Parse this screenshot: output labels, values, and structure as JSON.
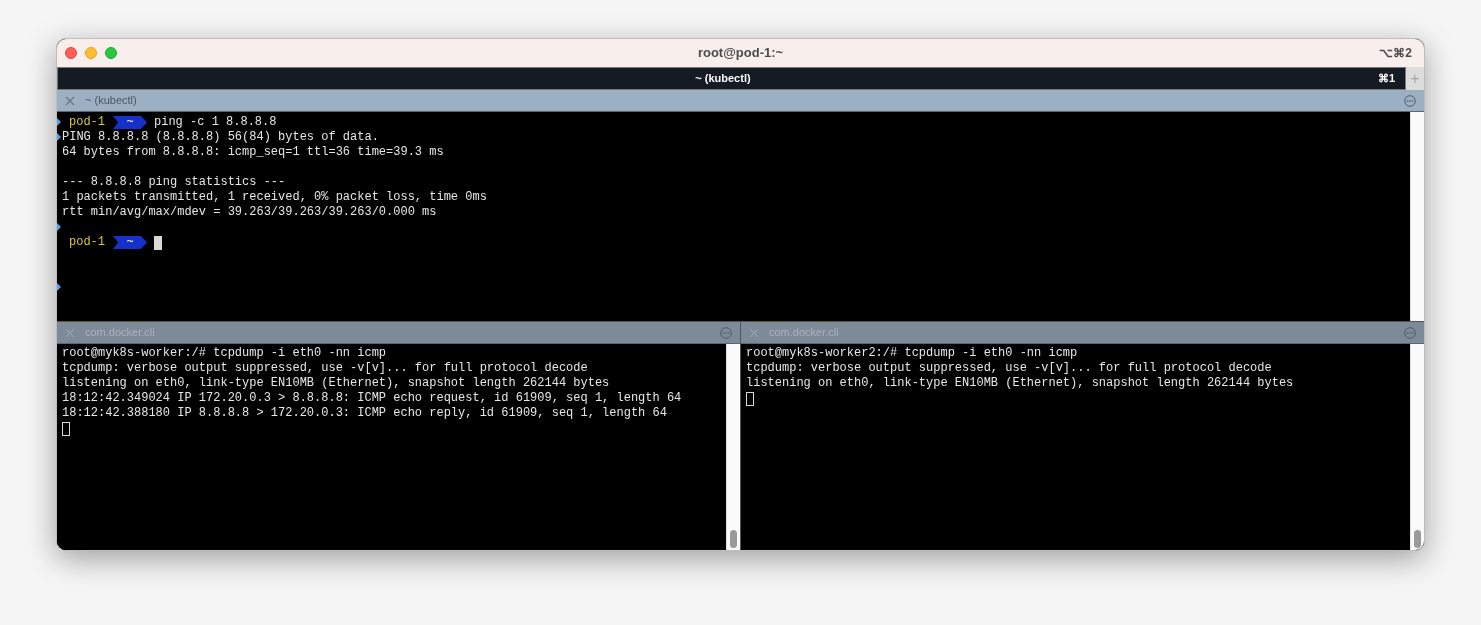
{
  "window": {
    "title": "root@pod-1:~",
    "shortcut": "⌥⌘2"
  },
  "tab_bar": {
    "tabs": [
      {
        "label": "~ (kubectl)",
        "shortcut": "⌘1",
        "selected": true
      }
    ],
    "new_tab": "+"
  },
  "top_pane": {
    "title": "~ (kubectl)",
    "active": true,
    "lines": [
      {
        "kind": "prompt",
        "marked": true,
        "host": "pod-1",
        "dir": "~",
        "command": "ping -c 1 8.8.8.8"
      },
      {
        "kind": "output",
        "marked": true,
        "text": "PING 8.8.8.8 (8.8.8.8) 56(84) bytes of data."
      },
      {
        "kind": "output",
        "marked": false,
        "text": "64 bytes from 8.8.8.8: icmp_seq=1 ttl=36 time=39.3 ms"
      },
      {
        "kind": "blank",
        "marked": false
      },
      {
        "kind": "output",
        "marked": false,
        "text": "--- 8.8.8.8 ping statistics ---"
      },
      {
        "kind": "output",
        "marked": false,
        "text": "1 packets transmitted, 1 received, 0% packet loss, time 0ms"
      },
      {
        "kind": "output",
        "marked": false,
        "text": "rtt min/avg/max/mdev = 39.263/39.263/39.263/0.000 ms"
      },
      {
        "kind": "blank",
        "marked": true
      },
      {
        "kind": "prompt",
        "marked": false,
        "host": "pod-1",
        "dir": "~",
        "cursor": true
      },
      {
        "kind": "blank",
        "marked": false
      },
      {
        "kind": "blank",
        "marked": false
      },
      {
        "kind": "blank",
        "marked": true
      }
    ]
  },
  "bottom_panes": [
    {
      "title": "com.docker.cli",
      "active": false,
      "lines": [
        {
          "kind": "output",
          "text": "root@myk8s-worker:/# tcpdump -i eth0 -nn icmp"
        },
        {
          "kind": "output",
          "text": "tcpdump: verbose output suppressed, use -v[v]... for full protocol decode"
        },
        {
          "kind": "output",
          "text": "listening on eth0, link-type EN10MB (Ethernet), snapshot length 262144 bytes"
        },
        {
          "kind": "output",
          "text": "18:12:42.349024 IP 172.20.0.3 > 8.8.8.8: ICMP echo request, id 61909, seq 1, length 64"
        },
        {
          "kind": "output",
          "text": "18:12:42.388180 IP 8.8.8.8 > 172.20.0.3: ICMP echo reply, id 61909, seq 1, length 64"
        },
        {
          "kind": "cursor",
          "cursor": true
        }
      ]
    },
    {
      "title": "com.docker.cli",
      "active": false,
      "lines": [
        {
          "kind": "output",
          "text": "root@myk8s-worker2:/# tcpdump -i eth0 -nn icmp"
        },
        {
          "kind": "output",
          "text": "tcpdump: verbose output suppressed, use -v[v]... for full protocol decode"
        },
        {
          "kind": "output",
          "text": "listening on eth0, link-type EN10MB (Ethernet), snapshot length 262144 bytes"
        },
        {
          "kind": "cursor",
          "cursor": true
        }
      ]
    }
  ]
}
